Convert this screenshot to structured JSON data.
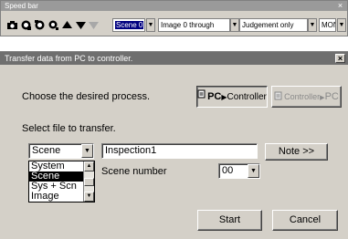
{
  "speedbar": {
    "title": "Speed bar",
    "close_glyph": "×",
    "tools": [
      {
        "icon": "camera-icon"
      },
      {
        "icon": "scene-tool-icon"
      },
      {
        "icon": "scene-group-icon"
      },
      {
        "icon": "measure-icon"
      },
      {
        "icon": "arrow-up-icon"
      },
      {
        "icon": "arrow-down-icon"
      },
      {
        "icon": "arrow-down-disabled-icon"
      }
    ],
    "scene_select": "Scene 0",
    "image_select": "Image 0 through",
    "judgement_select": "Judgement only",
    "monitor_select": "MON"
  },
  "dialog": {
    "title": "Transfer data from PC to controller.",
    "close_glyph": "×",
    "process_label": "Choose the desired process.",
    "pc_to_controller": {
      "left": "PC",
      "right": "Controller"
    },
    "controller_to_pc": {
      "left": "Controller",
      "right": "PC"
    },
    "file_label": "Select file to transfer.",
    "file_type_value": "Scene",
    "file_type_options": [
      "System",
      "Scene",
      "Sys + Scn",
      "Image"
    ],
    "file_type_selected": "Scene",
    "name_value": "Inspection1",
    "note_button": "Note >>",
    "scene_number_label": "Scene number",
    "scene_number_value": "00",
    "start_button": "Start",
    "cancel_button": "Cancel"
  },
  "colors": {
    "window_face": "#d4d0c8",
    "speedbar_title": "#9a9a9a",
    "dialog_title": "#6f6f6f",
    "selection": "#000000",
    "combo_selection": "#000080"
  }
}
